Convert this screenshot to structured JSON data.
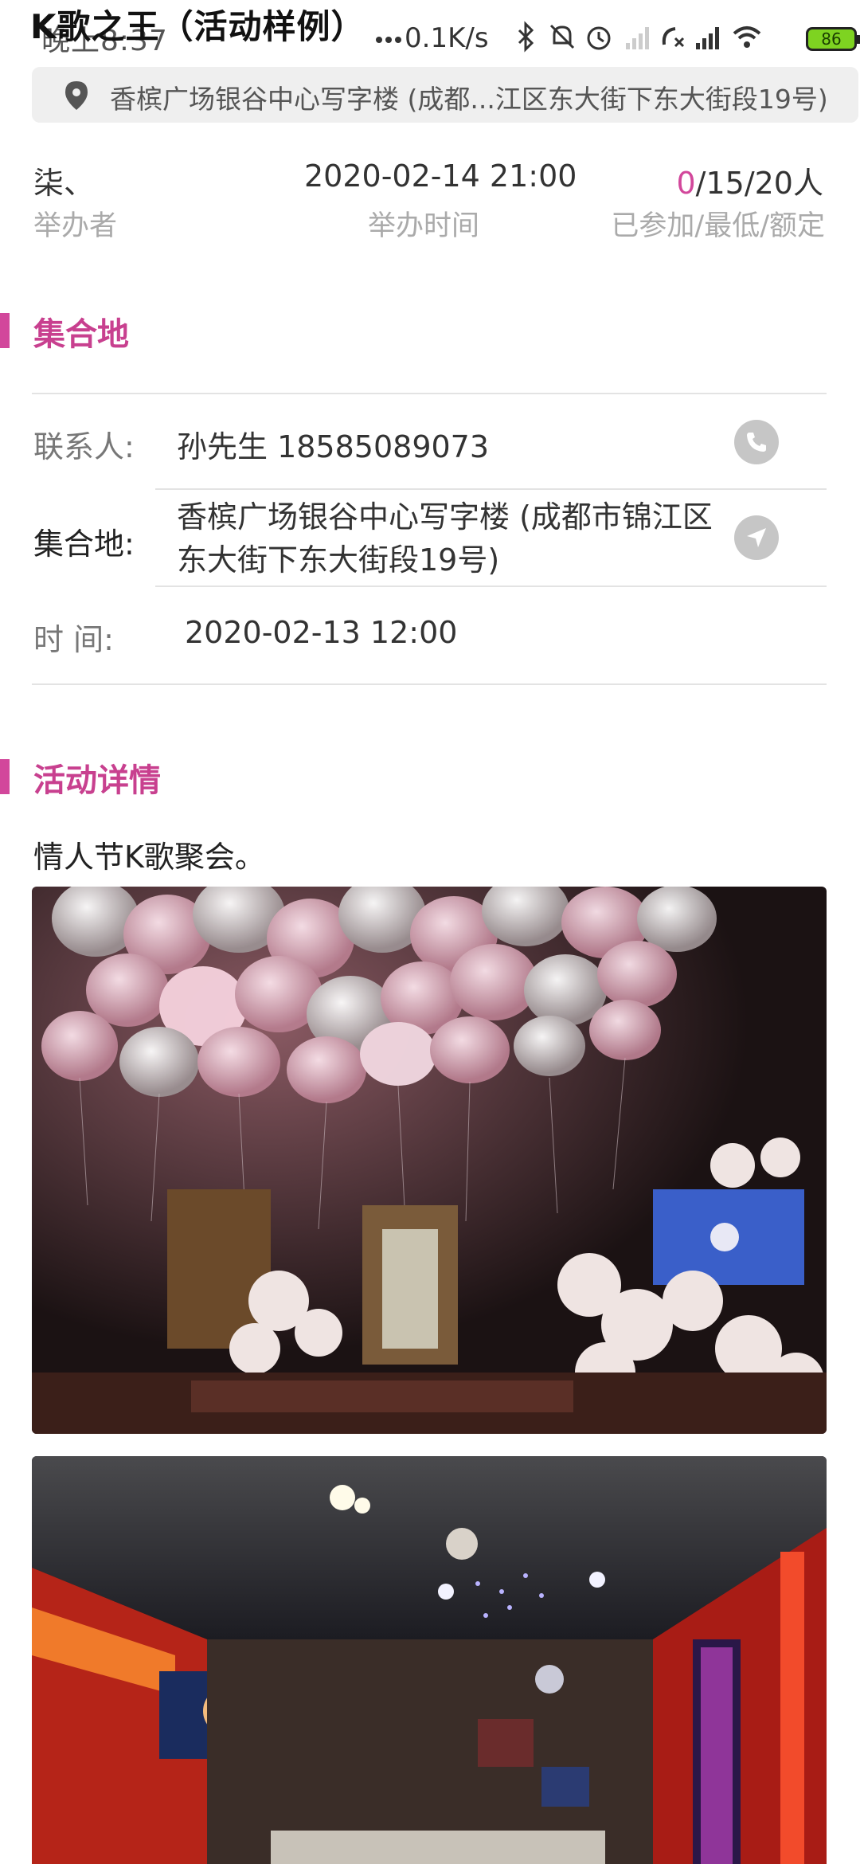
{
  "status_bar": {
    "time": "晚上8:37",
    "network_speed": "0.1K/s",
    "battery": "86",
    "icons": [
      "more-dots-icon",
      "bluetooth-icon",
      "mute-bell-icon",
      "alarm-icon",
      "signal-weak-icon",
      "call-blocked-icon",
      "signal-strong-icon",
      "wifi-icon",
      "battery-icon"
    ]
  },
  "app": {
    "title": "K歌之王（活动样例）"
  },
  "address_bar": {
    "icon": "location-pin-icon",
    "text": "香槟广场银谷中心写字楼 (成都...江区东大街下东大街段19号)"
  },
  "info": {
    "organizer": {
      "value": "柒、",
      "label": "举办者"
    },
    "time": {
      "value": "2020-02-14 21:00",
      "label": "举办时间"
    },
    "participants": {
      "joined": "0",
      "rest": "/15/20人",
      "label": "已参加/最低/额定"
    }
  },
  "meeting_section": {
    "title": "集合地",
    "contact": {
      "label": "联系人:",
      "value": "孙先生 18585089073",
      "icon": "phone-icon"
    },
    "place": {
      "label": "集合地:",
      "value": "香槟广场银谷中心写字楼 (成都市锦江区东大街下东大街段19号)",
      "icon": "navigate-icon"
    },
    "time": {
      "label": "时    间:",
      "value": "2020-02-13 12:00"
    }
  },
  "detail_section": {
    "title": "活动详情",
    "description": "情人节K歌聚会。"
  },
  "colors": {
    "accent": "#d2479b",
    "pill_bg": "#efefef",
    "label_gray": "#aaaaaa"
  }
}
